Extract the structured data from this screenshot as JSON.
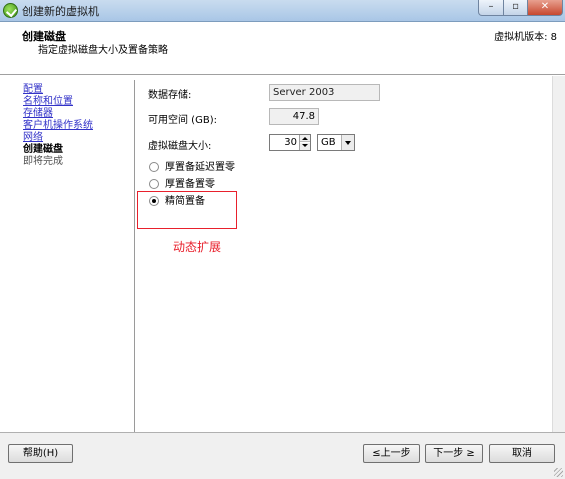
{
  "window": {
    "title": "创建新的虚拟机",
    "controls": {
      "minimize": "–",
      "maximize": "▫",
      "close": "✕"
    },
    "icon": "vsphere-check-icon"
  },
  "header": {
    "title": "创建磁盘",
    "subtitle": "指定虚拟磁盘大小及置备策略",
    "version": "虚拟机版本: 8"
  },
  "nav": {
    "items": [
      {
        "label": "配置",
        "state": "link"
      },
      {
        "label": "名称和位置",
        "state": "link"
      },
      {
        "label": "存储器",
        "state": "link"
      },
      {
        "label": "客户机操作系统",
        "state": "link"
      },
      {
        "label": "网络",
        "state": "link"
      },
      {
        "label": "创建磁盘",
        "state": "current"
      },
      {
        "label": "即将完成",
        "state": "future"
      }
    ]
  },
  "form": {
    "datastore_label": "数据存储:",
    "datastore_value": "Server 2003",
    "free_space_label": "可用空间 (GB):",
    "free_space_value": "47.8",
    "disk_size_label": "虚拟磁盘大小:",
    "disk_size_value": "30",
    "disk_size_unit": "GB",
    "provisioning_options": [
      {
        "label": "厚置备延迟置零",
        "checked": false
      },
      {
        "label": "厚置备置零",
        "checked": false
      },
      {
        "label": "精简置备",
        "checked": true
      }
    ]
  },
  "annotation": {
    "text": "动态扩展",
    "color": "#e8202c"
  },
  "footer": {
    "help": "帮助(H)",
    "back": "≤上一步",
    "next": "下一步 ≥",
    "cancel": "取消"
  }
}
